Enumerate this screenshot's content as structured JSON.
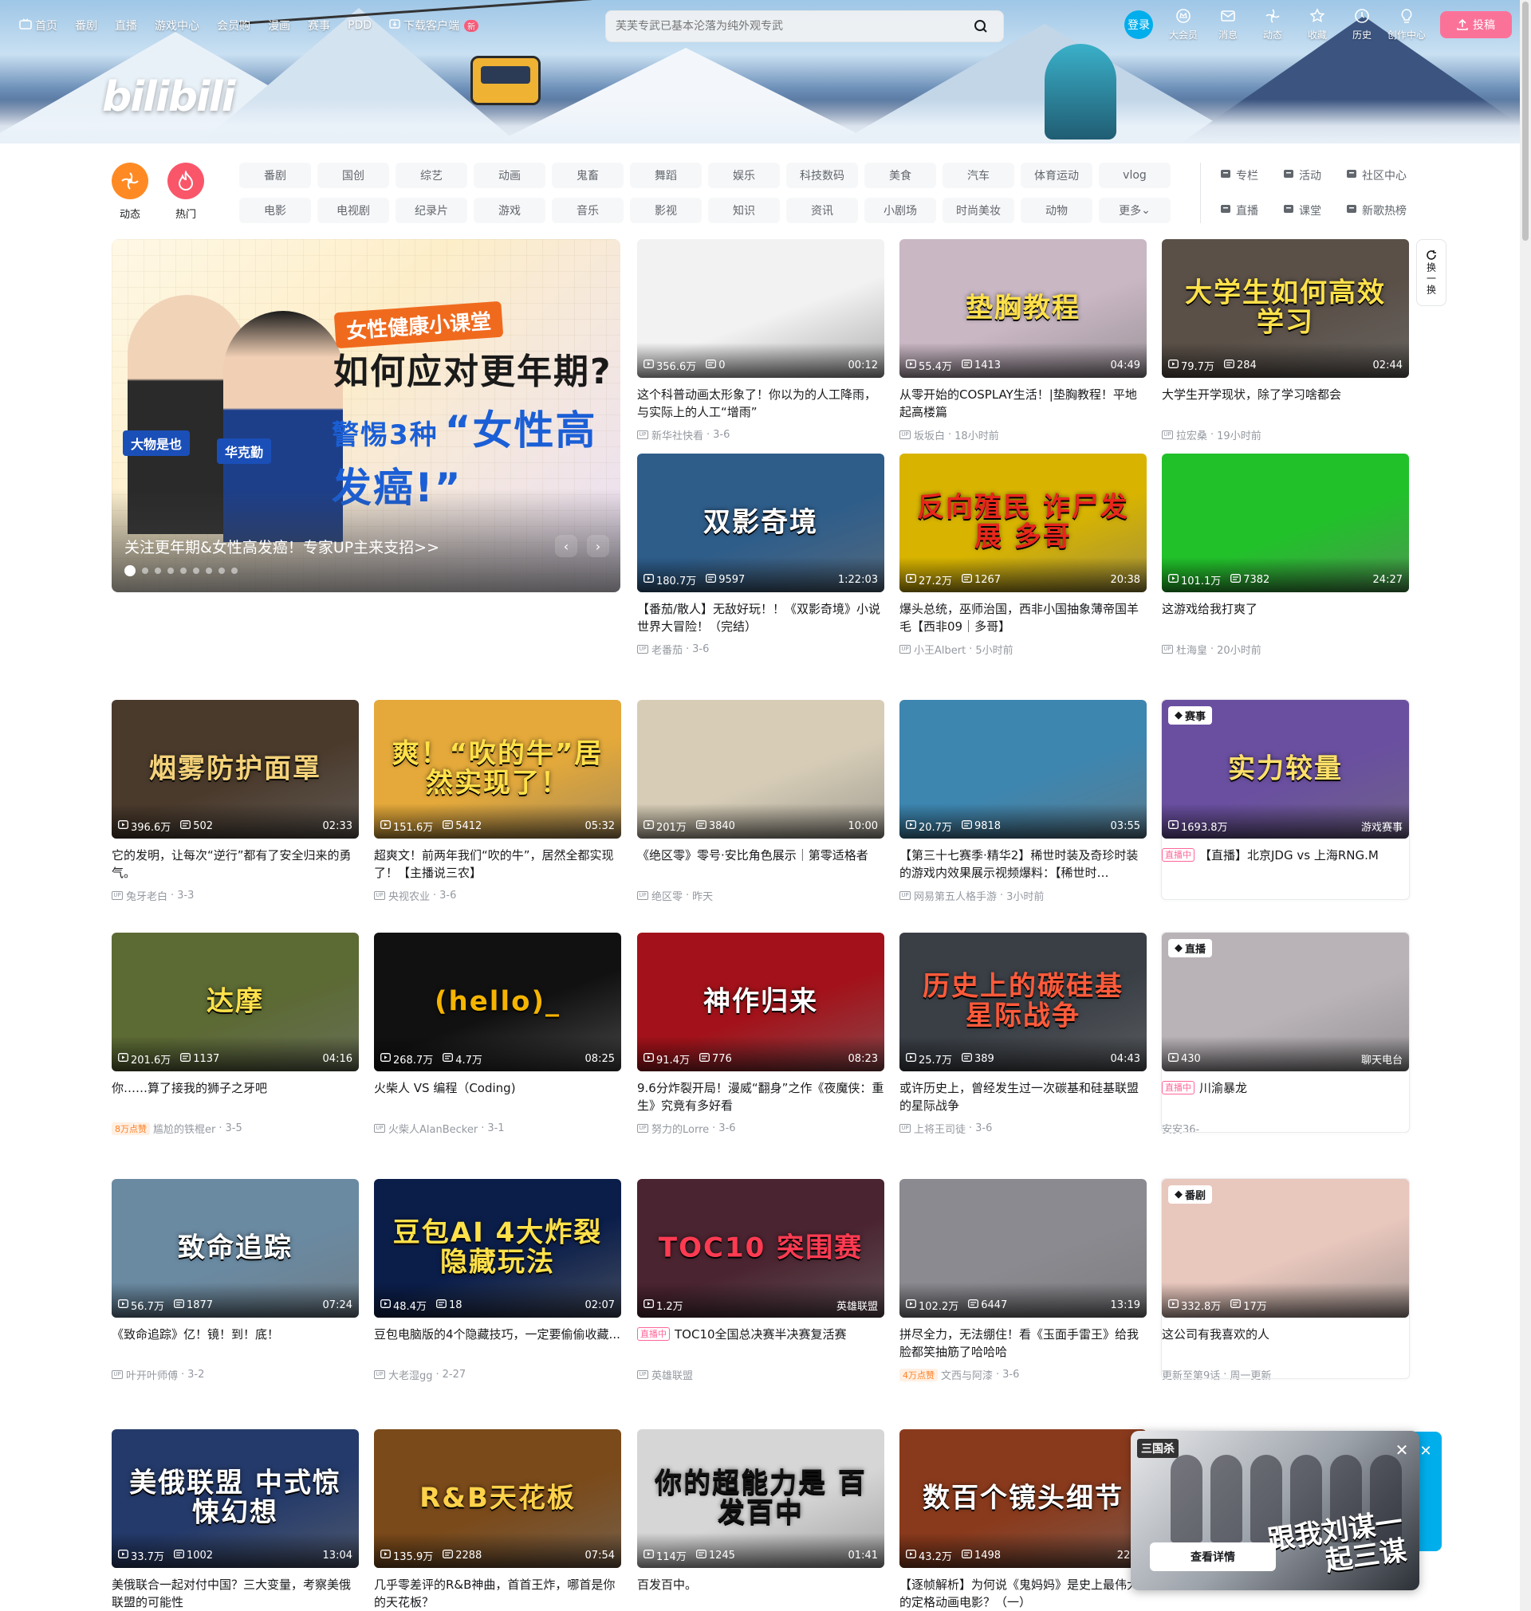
{
  "nav": {
    "left": [
      {
        "label": "首页",
        "icon": "tv-icon"
      },
      {
        "label": "番剧"
      },
      {
        "label": "直播"
      },
      {
        "label": "游戏中心"
      },
      {
        "label": "会员购"
      },
      {
        "label": "漫画"
      },
      {
        "label": "赛事"
      },
      {
        "label": "PDD"
      },
      {
        "label": "下载客户端",
        "icon": "download-icon",
        "badge": "新"
      }
    ],
    "search_placeholder": "芙芙专武已基本沦落为纯外观专武",
    "login": "登录",
    "right": [
      {
        "label": "大会员"
      },
      {
        "label": "消息"
      },
      {
        "label": "动态"
      },
      {
        "label": "收藏"
      },
      {
        "label": "历史"
      },
      {
        "label": "创作中心"
      }
    ],
    "upload": "投稿",
    "logo": "bilibili"
  },
  "channels": {
    "feed": "动态",
    "hot": "热门",
    "tags": [
      "番剧",
      "国创",
      "综艺",
      "动画",
      "鬼畜",
      "舞蹈",
      "娱乐",
      "科技数码",
      "美食",
      "汽车",
      "体育运动",
      "vlog",
      "电影",
      "电视剧",
      "纪录片",
      "游戏",
      "音乐",
      "影视",
      "知识",
      "资讯",
      "小剧场",
      "时尚美妆",
      "动物",
      "更多"
    ],
    "side": [
      {
        "label": "专栏"
      },
      {
        "label": "活动"
      },
      {
        "label": "社区中心"
      },
      {
        "label": "直播"
      },
      {
        "label": "课堂"
      },
      {
        "label": "新歌热榜"
      }
    ]
  },
  "carousel": {
    "tag": "女性健康小课堂",
    "line1": "如何应对更年期?",
    "line2a": "警惕3种",
    "line2b": "“女性高发癌!”",
    "name1": "大物是也",
    "name2": "华克勤",
    "caption": "关注更年期&女性高发癌！专家UP主来支招>>"
  },
  "refresh": "换一换",
  "videos": [
    {
      "title": "这个科普动画太形象了！你以为的人工降雨，与实际上的人工“增雨”",
      "up": "新华社快看",
      "date": "3-6",
      "views": "356.6万",
      "danmaku": "0",
      "dur": "00:12",
      "bg": "#f2f2f2",
      "fg": "#111"
    },
    {
      "title": "从零开始的COSPLAY生活！|垫胸教程！平地起高楼篇",
      "up": "坂坂白",
      "date": "18小时前",
      "views": "55.4万",
      "danmaku": "1413",
      "dur": "04:49",
      "bg": "#c9b7c4",
      "thumbtext": "垫胸教程",
      "fg": "#ffe14a"
    },
    {
      "title": "大学生开学现状，除了学习啥都会",
      "up": "拉宏桑",
      "date": "19小时前",
      "views": "79.7万",
      "danmaku": "284",
      "dur": "02:44",
      "bg": "#5a5048",
      "thumbtext": "大学生如何高效学习",
      "fg": "#ffe14a"
    },
    {
      "title": "【番茄/散人】无敌好玩！！《双影奇境》小说世界大冒险！（完结）",
      "up": "老番茄",
      "date": "3-6",
      "views": "180.7万",
      "danmaku": "9597",
      "dur": "1:22:03",
      "bg": "#2e5d8a",
      "thumbtext": "双影奇境",
      "fg": "#fff"
    },
    {
      "title": "爆头总统，巫师治国，西非小国抽象薄帝国羊毛【西非09｜多哥】",
      "up": "小王Albert",
      "date": "5小时前",
      "views": "27.2万",
      "danmaku": "1267",
      "dur": "20:38",
      "bg": "#d8b400",
      "thumbtext": "反向殖民 诈尸发展 多哥",
      "fg": "#e8261c"
    },
    {
      "title": "这游戏给我打爽了",
      "up": "杜海皇",
      "date": "20小时前",
      "views": "101.1万",
      "danmaku": "7382",
      "dur": "24:27",
      "bg": "#21c12a",
      "fg": "#fff"
    },
    {
      "title": "它的发明，让每次“逆行”都有了安全归来的勇气。",
      "up": "兔牙老白",
      "date": "3-3",
      "views": "396.6万",
      "danmaku": "502",
      "dur": "02:33",
      "bg": "#4a3a2c",
      "thumbtext": "烟雾防护面罩",
      "fg": "#f4d27a"
    },
    {
      "title": "超爽文！前两年我们“吹的牛”，居然全都实现了！【主播说三农】",
      "up": "央视农业",
      "date": "3-6",
      "views": "151.6万",
      "danmaku": "5412",
      "dur": "05:32",
      "bg": "#e4a93a",
      "thumbtext": "爽！“吹的牛”居然实现了！",
      "fg": "#ffe14a"
    },
    {
      "title": "《绝区零》零号·安比角色展示｜第零适格者",
      "up": "绝区零",
      "date": "昨天",
      "views": "201万",
      "danmaku": "3840",
      "dur": "10:00",
      "bg": "#d7cdb7",
      "fg": "#fff"
    },
    {
      "title": "【第三十七赛季·精华2】稀世时装及奇珍时装的游戏内效果展示视频爆料：【稀世时…",
      "up": "网易第五人格手游",
      "date": "3小时前",
      "views": "20.7万",
      "danmaku": "9818",
      "dur": "03:55",
      "bg": "#3d86b0",
      "fg": "#fff"
    },
    {
      "title": "【直播】北京JDG vs 上海RNG.M",
      "up": "",
      "date": "",
      "views": "1693.8万",
      "danmaku": "",
      "dur": "游戏赛事",
      "bg": "#6a4fa0",
      "thumbtext": "实力较量",
      "fg": "#ffe06a",
      "badge": "赛事",
      "live": "直播中",
      "boxed": true
    },
    {
      "title": "你……算了接我的狮子之牙吧",
      "up": "尴尬的铁棍er",
      "date": "3-5",
      "views": "201.6万",
      "danmaku": "1137",
      "dur": "04:16",
      "bg": "#5c6a34",
      "thumbtext": "达摩",
      "fg": "#ffe14a",
      "hot": "8万点赞"
    },
    {
      "title": "火柴人 VS 编程（Coding)",
      "up": "火柴人AlanBecker",
      "date": "3-1",
      "views": "268.7万",
      "danmaku": "4.7万",
      "dur": "08:25",
      "bg": "#111",
      "thumbtext": "(hello)_",
      "fg": "#f5b400"
    },
    {
      "title": "9.6分炸裂开局！漫威“翻身”之作《夜魔侠：重生》究竟有多好看",
      "up": "努力的Lorre",
      "date": "3-6",
      "views": "91.4万",
      "danmaku": "776",
      "dur": "08:23",
      "bg": "#a3121a",
      "thumbtext": "神作归来",
      "fg": "#fff"
    },
    {
      "title": "或许历史上，曾经发生过一次碳基和硅基联盟的星际战争",
      "up": "上将王司徒",
      "date": "3-6",
      "views": "25.7万",
      "danmaku": "389",
      "dur": "04:43",
      "bg": "#3a3f46",
      "thumbtext": "历史上的碳硅基星际战争",
      "fg": "#ff5a3a"
    },
    {
      "title": "川渝暴龙",
      "up": "安安36-",
      "date": "",
      "views": "430",
      "danmaku": "",
      "dur": "聊天电台",
      "bg": "#b9b3b8",
      "badge": "直播",
      "live": "直播中",
      "boxed": true
    },
    {
      "title": "《致命追踪》亿！镜！到！底！",
      "up": "叶开叶师傅",
      "date": "3-2",
      "views": "56.7万",
      "danmaku": "1877",
      "dur": "07:24",
      "bg": "#6a8aa2",
      "thumbtext": "致命追踪",
      "fg": "#fff"
    },
    {
      "title": "豆包电脑版的4个隐藏技巧，一定要偷偷收藏...",
      "up": "大老湿gg",
      "date": "2-27",
      "views": "48.4万",
      "danmaku": "18",
      "dur": "02:07",
      "bg": "#0b1e4a",
      "thumbtext": "豆包AI 4大炸裂隐藏玩法",
      "fg": "#ffe14a"
    },
    {
      "title": "TOC10全国总决赛半决赛复活赛",
      "up": "英雄联盟",
      "date": "",
      "views": "1.2万",
      "danmaku": "",
      "dur": "英雄联盟",
      "bg": "#4a2430",
      "thumbtext": "TOC10 突围赛",
      "fg": "#ff3b52",
      "live": "直播中"
    },
    {
      "title": "拼尽全力，无法绷住！看《玉面手雷王》给我脸都笑抽筋了哈哈哈",
      "up": "文西与阿漆",
      "date": "3-6",
      "views": "102.2万",
      "danmaku": "6447",
      "dur": "13:19",
      "bg": "#8a8a90",
      "fg": "#fff",
      "hot": "4万点赞"
    },
    {
      "title": "这公司有我喜欢的人",
      "up": "更新至第9话",
      "date": "周一更新",
      "views": "332.8万",
      "danmaku": "17万",
      "dur": "",
      "bg": "#e8c7bd",
      "badge": "番剧",
      "boxed": true
    },
    {
      "title": "美俄联合一起对付中国？三大变量，考察美俄联盟的可能性",
      "up": "",
      "date": "",
      "views": "33.7万",
      "danmaku": "1002",
      "dur": "13:04",
      "bg": "#243a6a",
      "thumbtext": "美俄联盟 中式惊悚幻想",
      "fg": "#fff"
    },
    {
      "title": "几乎零差评的R&B神曲，首首王炸，哪首是你的天花板？",
      "up": "",
      "date": "",
      "views": "135.9万",
      "danmaku": "2288",
      "dur": "07:54",
      "bg": "#7a4a1a",
      "thumbtext": "R&B天花板",
      "fg": "#ffd24a"
    },
    {
      "title": "百发百中。",
      "up": "",
      "date": "",
      "views": "114万",
      "danmaku": "1245",
      "dur": "01:41",
      "bg": "#d6d6d6",
      "thumbtext": "你的超能力是 百发百中",
      "fg": "#111"
    },
    {
      "title": "【逐帧解析】为何说《鬼妈妈》是史上最伟大的定格动画电影？（一）",
      "up": "",
      "date": "",
      "views": "43.2万",
      "danmaku": "1498",
      "dur": "22:3",
      "bg": "#8a3a1c",
      "thumbtext": "数百个镜头细节",
      "fg": "#fff"
    }
  ],
  "popup": {
    "tag": "三国杀",
    "slogan": "跟我刘谋一起三谋",
    "cta": "查看详情"
  }
}
